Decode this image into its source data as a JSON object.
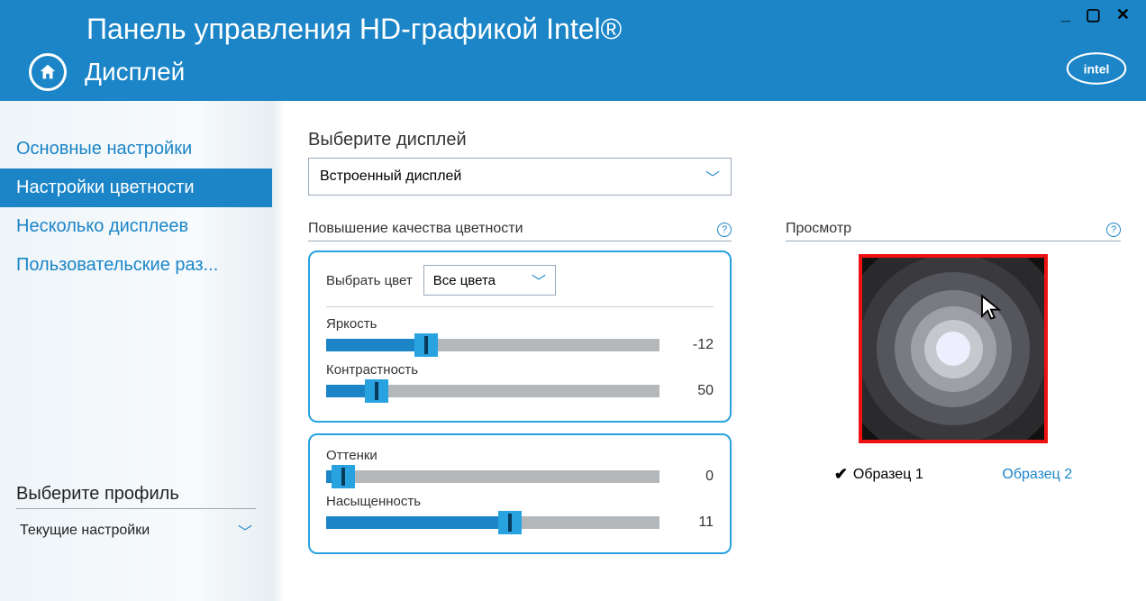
{
  "header": {
    "app_title": "Панель управления HD-графикой Intel®",
    "section": "Дисплей"
  },
  "sidebar": {
    "items": [
      {
        "label": "Основные настройки"
      },
      {
        "label": "Настройки цветности"
      },
      {
        "label": "Несколько дисплеев"
      },
      {
        "label": "Пользовательские раз..."
      }
    ],
    "profile_label": "Выберите профиль",
    "profile_value": "Текущие настройки"
  },
  "main": {
    "display_label": "Выберите дисплей",
    "display_value": "Встроенный дисплей",
    "color_section": "Повышение качества цветности",
    "select_color_label": "Выбрать цвет",
    "select_color_value": "Все цвета",
    "sliders_a": [
      {
        "label": "Яркость",
        "value": "-12",
        "percent": 30
      },
      {
        "label": "Контрастность",
        "value": "50",
        "percent": 15
      }
    ],
    "sliders_b": [
      {
        "label": "Оттенки",
        "value": "0",
        "percent": 5
      },
      {
        "label": "Насыщенность",
        "value": "11",
        "percent": 55
      }
    ],
    "preview_label": "Просмотр",
    "sample1": "Образец 1",
    "sample2": "Образец 2"
  }
}
